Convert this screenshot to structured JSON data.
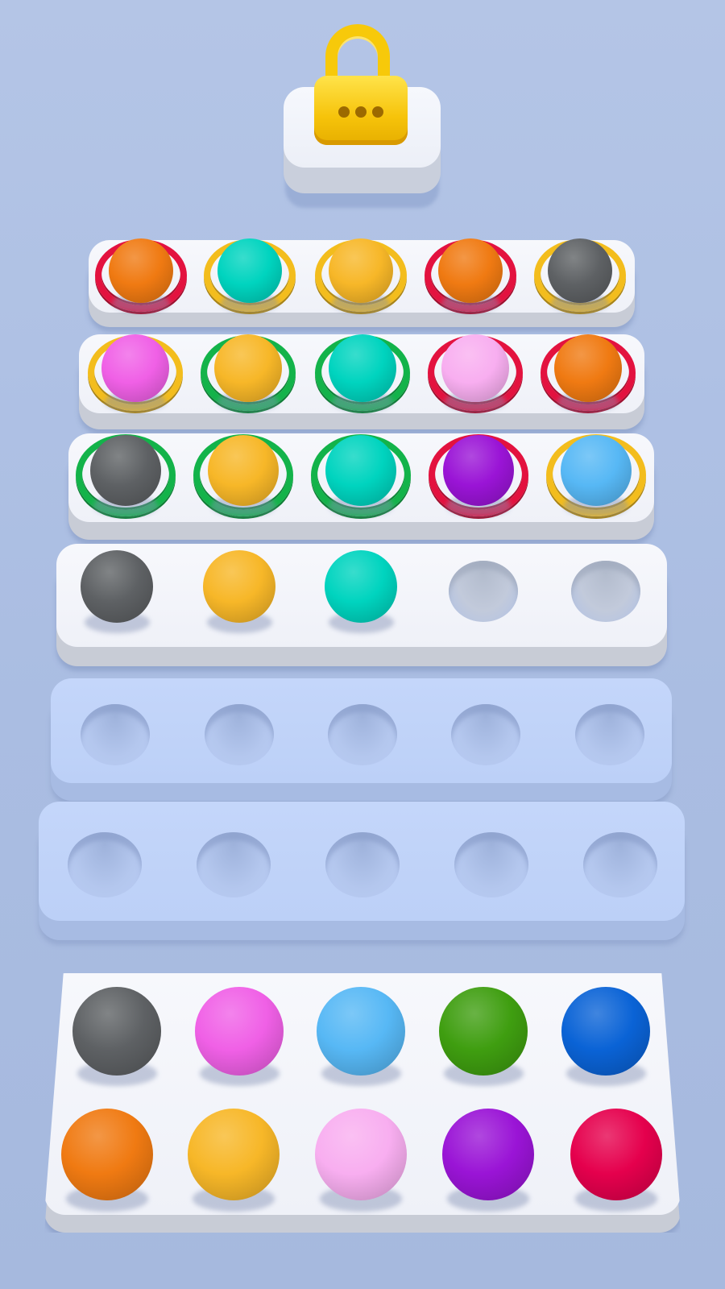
{
  "locked_item": {
    "icon": "padlock-icon",
    "color": "#f7c90a"
  },
  "colors": {
    "orange": "#f07a12",
    "teal": "#00d4bf",
    "yellow": "#f7b728",
    "gray": "#5e6164",
    "pink": "#f060e6",
    "lightpink": "#f8aef0",
    "purple": "#9a14d6",
    "skyblue": "#57b8f5",
    "green": "#3f9e10",
    "blue": "#0a63d6",
    "crimson": "#e5004d",
    "ring_red": "#e3123f",
    "ring_yellow": "#f3bd1d",
    "ring_green": "#13b34a"
  },
  "board": {
    "rows": [
      {
        "state": "filled",
        "slots": [
          {
            "ball": "orange",
            "ring": "ring_red"
          },
          {
            "ball": "teal",
            "ring": "ring_yellow"
          },
          {
            "ball": "yellow",
            "ring": "ring_yellow"
          },
          {
            "ball": "orange",
            "ring": "ring_red"
          },
          {
            "ball": "gray",
            "ring": "ring_yellow"
          }
        ]
      },
      {
        "state": "filled",
        "slots": [
          {
            "ball": "pink",
            "ring": "ring_yellow"
          },
          {
            "ball": "yellow",
            "ring": "ring_green"
          },
          {
            "ball": "teal",
            "ring": "ring_green"
          },
          {
            "ball": "lightpink",
            "ring": "ring_red"
          },
          {
            "ball": "orange",
            "ring": "ring_red"
          }
        ]
      },
      {
        "state": "filled",
        "slots": [
          {
            "ball": "gray",
            "ring": "ring_green"
          },
          {
            "ball": "yellow",
            "ring": "ring_green"
          },
          {
            "ball": "teal",
            "ring": "ring_green"
          },
          {
            "ball": "purple",
            "ring": "ring_red"
          },
          {
            "ball": "skyblue",
            "ring": "ring_yellow"
          }
        ]
      },
      {
        "state": "active",
        "slots": [
          {
            "ball": "gray",
            "ring": null
          },
          {
            "ball": "yellow",
            "ring": null
          },
          {
            "ball": "teal",
            "ring": null
          },
          {
            "ball": null,
            "ring": null
          },
          {
            "ball": null,
            "ring": null
          }
        ]
      },
      {
        "state": "empty",
        "slots": [
          {
            "ball": null,
            "ring": null
          },
          {
            "ball": null,
            "ring": null
          },
          {
            "ball": null,
            "ring": null
          },
          {
            "ball": null,
            "ring": null
          },
          {
            "ball": null,
            "ring": null
          }
        ]
      },
      {
        "state": "empty",
        "slots": [
          {
            "ball": null,
            "ring": null
          },
          {
            "ball": null,
            "ring": null
          },
          {
            "ball": null,
            "ring": null
          },
          {
            "ball": null,
            "ring": null
          },
          {
            "ball": null,
            "ring": null
          }
        ]
      }
    ]
  },
  "palette": {
    "rows": [
      [
        "gray",
        "pink",
        "skyblue",
        "green",
        "blue"
      ],
      [
        "orange",
        "yellow",
        "lightpink",
        "purple",
        "crimson"
      ]
    ]
  }
}
